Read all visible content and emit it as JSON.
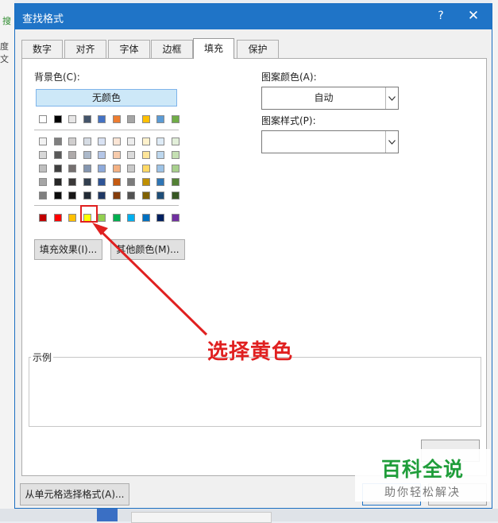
{
  "background": {
    "left_text_1": "搜",
    "left_text_2": "度文"
  },
  "dialog": {
    "title": "查找格式",
    "help_glyph": "?",
    "close_glyph": "✕"
  },
  "tabs": [
    {
      "label": "数字",
      "active": false
    },
    {
      "label": "对齐",
      "active": false
    },
    {
      "label": "字体",
      "active": false
    },
    {
      "label": "边框",
      "active": false
    },
    {
      "label": "填充",
      "active": true
    },
    {
      "label": "保护",
      "active": false
    }
  ],
  "fill": {
    "background_color_label": "背景色(C):",
    "no_color_label": "无颜色",
    "theme_top_row": [
      "#ffffff",
      "#000000",
      "#e7e6e6",
      "#44546a",
      "#4472c4",
      "#ed7d31",
      "#a5a5a5",
      "#ffc000",
      "#5b9bd5",
      "#70ad47"
    ],
    "theme_shades": [
      [
        "#f2f2f2",
        "#7f7f7f",
        "#d0cece",
        "#d6dce4",
        "#d9e2f3",
        "#fbe5d5",
        "#ededed",
        "#fff2cc",
        "#deebf6",
        "#e2efd9"
      ],
      [
        "#d8d8d8",
        "#595959",
        "#aeaaaa",
        "#acb9ca",
        "#b4c6e7",
        "#f7cbac",
        "#dbdbdb",
        "#fee599",
        "#bdd7ee",
        "#c5e0b3"
      ],
      [
        "#bfbfbf",
        "#3f3f3f",
        "#757070",
        "#8496b0",
        "#8eaadb",
        "#f4b183",
        "#c9c9c9",
        "#ffd965",
        "#9dc3e6",
        "#a8d08d"
      ],
      [
        "#a5a5a5",
        "#262626",
        "#3a3838",
        "#323f4f",
        "#2f5496",
        "#c55a11",
        "#7b7b7b",
        "#bf8f00",
        "#2e75b5",
        "#538135"
      ],
      [
        "#7f7f7f",
        "#0c0c0c",
        "#171616",
        "#222a35",
        "#1f3864",
        "#843c0b",
        "#525252",
        "#7f6000",
        "#1e4e79",
        "#375623"
      ]
    ],
    "standard_colors": [
      "#c00000",
      "#ff0000",
      "#ffc000",
      "#ffff00",
      "#92d050",
      "#00b050",
      "#00b0f0",
      "#0070c0",
      "#002060",
      "#7030a0"
    ],
    "selected_standard_index": 3,
    "fill_effects_label": "填充效果(I)...",
    "more_colors_label": "其他颜色(M)...",
    "pattern_color_label": "图案颜色(A):",
    "pattern_color_value": "自动",
    "pattern_style_label": "图案样式(P):",
    "pattern_style_value": "",
    "sample_label": "示例"
  },
  "annotation": {
    "text": "选择黄色"
  },
  "footer": {
    "choose_from_cell_label": "从单元格选择格式(A)..."
  },
  "watermark": {
    "line1": "百科全说",
    "line2": "助你轻松解决"
  }
}
